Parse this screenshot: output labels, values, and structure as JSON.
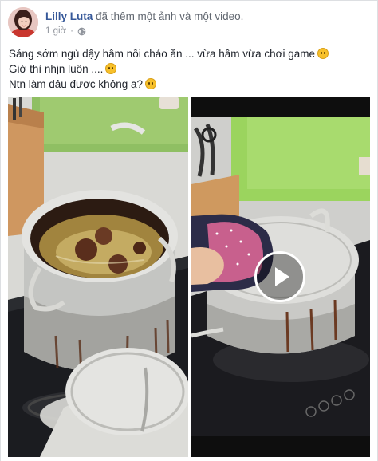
{
  "post": {
    "author": "Lilly Luta",
    "action": "đã thêm một ảnh và một video.",
    "time": "1 giờ",
    "privacy_icon": "globe-icon",
    "text_lines": [
      "Sáng sớm ngủ dậy hâm nồi cháo ăn ... vừa hâm vừa chơi game",
      "Giờ thì nhịn luôn ....",
      "Ntn làm dâu được không ạ?"
    ],
    "emojis": [
      "grinning-face-emoji",
      "sweat-smile-emoji",
      "rolling-eyes-emoji"
    ]
  },
  "media": {
    "photo_subject": "burnt-porridge-pot-photo",
    "video_subject": "pot-on-stove-video",
    "play_icon": "play-icon"
  },
  "colors": {
    "author_link": "#365899",
    "meta_gray": "#90949c",
    "body_text": "#1d2129",
    "emoji_yellow": "#f7c02b"
  }
}
